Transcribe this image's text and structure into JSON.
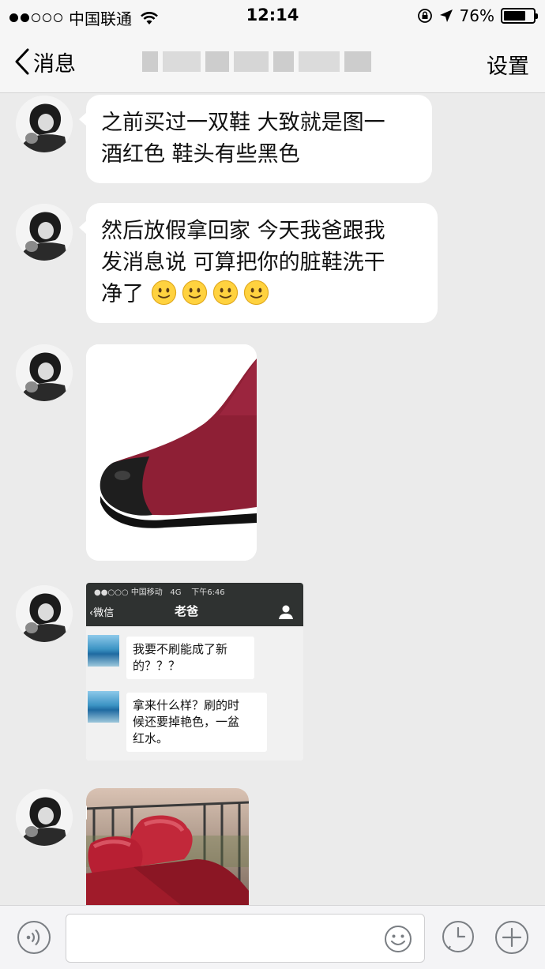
{
  "status_bar": {
    "carrier": "中国联通",
    "time": "12:14",
    "battery_percent": "76%",
    "battery_level": 0.76
  },
  "nav": {
    "back_label": "消息",
    "settings_label": "设置"
  },
  "messages": [
    {
      "type": "text",
      "text_lines": [
        "之前买过一双鞋 大致就是图一",
        "酒红色 鞋头有些黑色"
      ]
    },
    {
      "type": "text",
      "text_lines": [
        "然后放假拿回家 今天我爸跟我",
        "发消息说   可算把你的脏鞋洗干",
        "净了"
      ],
      "emoji_count": 4,
      "emoji": "smile-emoji"
    },
    {
      "type": "image",
      "description_icon": "burgundy-boot-image"
    },
    {
      "type": "screenshot",
      "screenshot": {
        "carrier": "中国移动",
        "network": "4G",
        "time": "下午6:46",
        "back_label": "微信",
        "title": "老爸",
        "messages": [
          {
            "text_lines": [
              "我要不刷能成了新",
              "的？？？"
            ]
          },
          {
            "text_lines": [
              "拿来什么样？刷的时",
              "候还要掉艳色，一盆",
              "红水。"
            ]
          }
        ]
      }
    },
    {
      "type": "image",
      "description_icon": "red-fur-boots-photo"
    }
  ],
  "colors": {
    "background": "#ebebeb",
    "bubble": "#ffffff",
    "bar": "#f6f6f6"
  }
}
